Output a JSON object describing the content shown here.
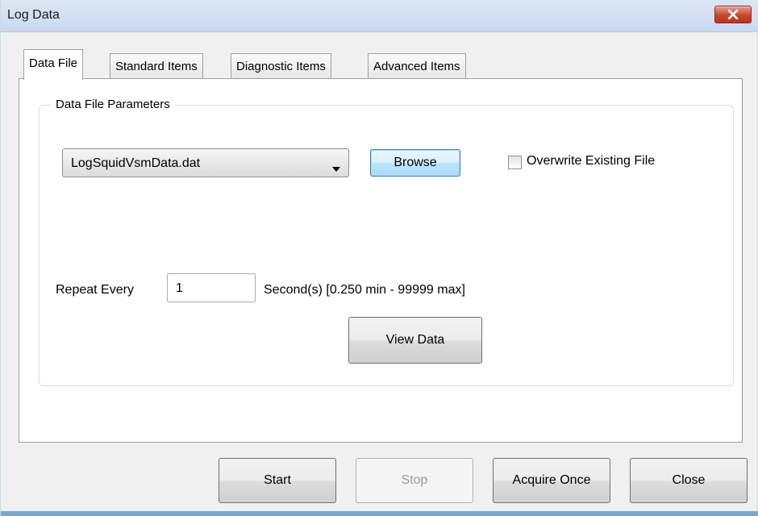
{
  "window": {
    "title": "Log Data"
  },
  "tabs": [
    {
      "label": "Data File",
      "active": true
    },
    {
      "label": "Standard Items",
      "active": false
    },
    {
      "label": "Diagnostic Items",
      "active": false
    },
    {
      "label": "Advanced Items",
      "active": false
    }
  ],
  "data_file": {
    "group_title": "Data File Parameters",
    "file_select": {
      "value": "LogSquidVsmData.dat"
    },
    "browse_label": "Browse",
    "overwrite": {
      "label": "Overwrite Existing File",
      "checked": false
    },
    "repeat_label": "Repeat Every",
    "repeat_value": "1",
    "repeat_units": "Second(s) [0.250 min - 99999 max]",
    "view_data_label": "View Data"
  },
  "footer": {
    "start_label": "Start",
    "stop_label": "Stop",
    "acquire_once_label": "Acquire Once",
    "close_label": "Close"
  },
  "icons": {
    "close": "close-icon",
    "dropdown": "chevron-down-icon"
  },
  "colors": {
    "close_button": "#c7462f",
    "titlebar": "#dbe6f4",
    "focus_button": "#bee6fd"
  }
}
